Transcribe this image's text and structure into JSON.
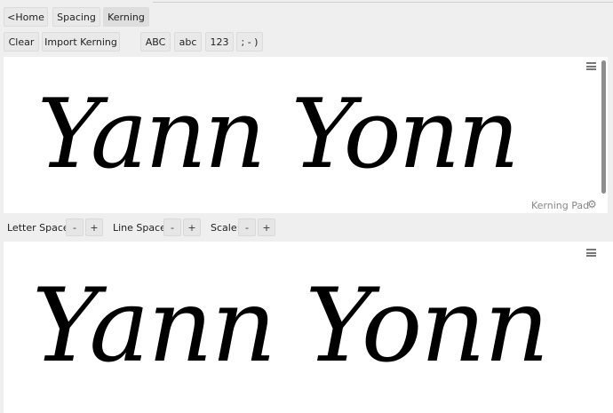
{
  "nav": {
    "home_label": "<Home",
    "spacing_label": "Spacing",
    "kerning_label": "Kerning"
  },
  "toolbar": {
    "clear_label": "Clear",
    "import_label": "Import Kerning",
    "upper_label": "ABC",
    "lower_label": "abc",
    "digits_label": "123",
    "punct_label": "; - )"
  },
  "kerning_pad": {
    "text": "Yann Yonn",
    "label": "Kerning Pad"
  },
  "controls": {
    "letter_space_label": "Letter Space:",
    "line_space_label": "Line Space:",
    "scale_label": "Scale:",
    "minus": "-",
    "plus": "+"
  },
  "preview": {
    "text": "Yann Yonn"
  },
  "icons": {
    "menu": "hamburger-icon",
    "settings": "gear-icon"
  }
}
